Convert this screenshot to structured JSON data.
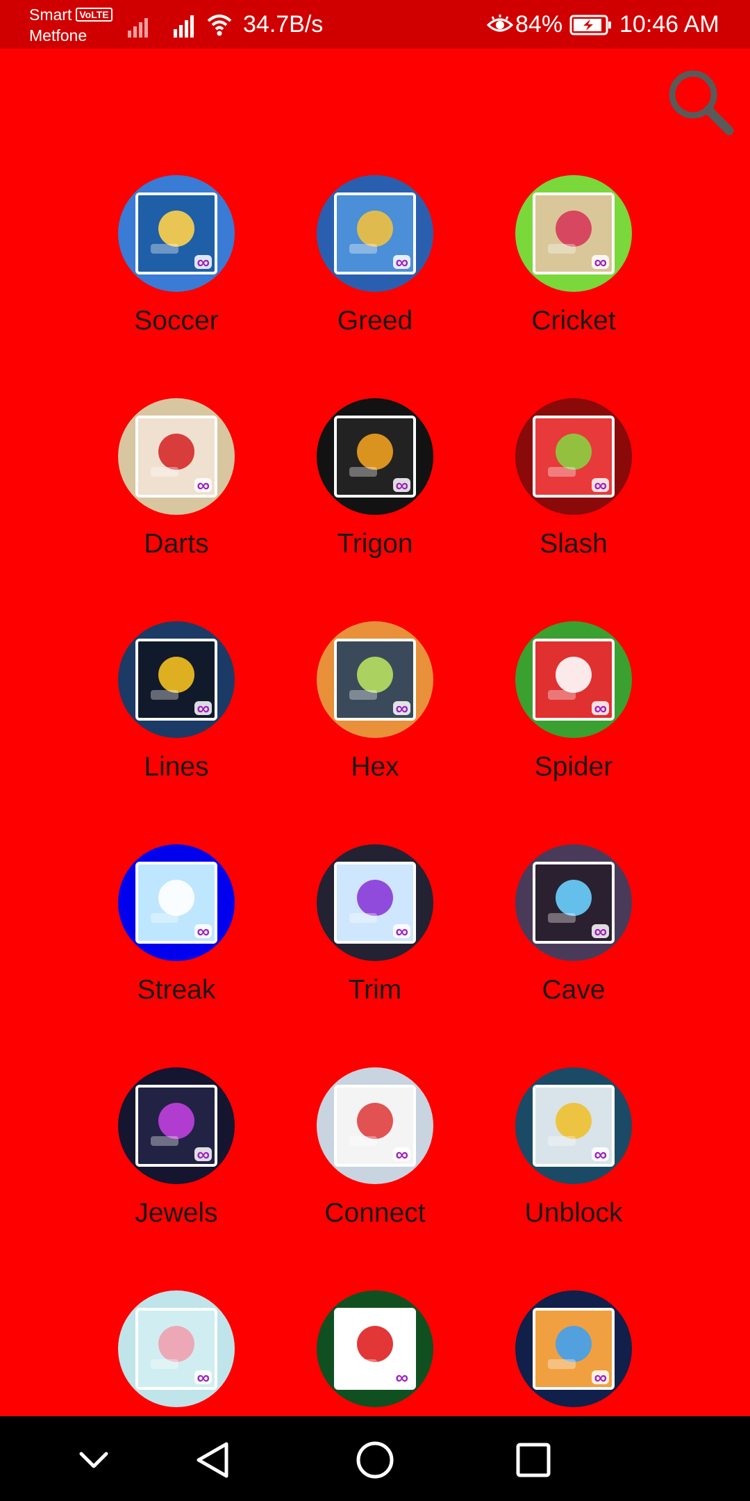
{
  "status_bar": {
    "carrier_line1": "Smart",
    "volte": "VoLTE",
    "carrier_line2": "Metfone",
    "net_speed": "34.7B/s",
    "battery_percent": "84%",
    "time": "10:46 AM"
  },
  "colors": {
    "background": "#fe0000",
    "status_bar": "#d10000",
    "nav_bar": "#000000"
  },
  "search": {
    "icon": "search-icon"
  },
  "games": [
    {
      "label": "Soccer",
      "circle": "#3a7bd5",
      "inner": "#1e5fa8",
      "accent": "#ffd24a"
    },
    {
      "label": "Greed",
      "circle": "#2a5fb0",
      "inner": "#4a8fd8",
      "accent": "#f0c040"
    },
    {
      "label": "Cricket",
      "circle": "#7ad83a",
      "inner": "#d9c79a",
      "accent": "#d63a5a"
    },
    {
      "label": "Darts",
      "circle": "#d8c6a0",
      "inner": "#f0e0d0",
      "accent": "#d52a2a"
    },
    {
      "label": "Trigon",
      "circle": "#121212",
      "inner": "#222222",
      "accent": "#f0a020"
    },
    {
      "label": "Slash",
      "circle": "#8a0a0a",
      "inner": "#e83a3a",
      "accent": "#8ad040"
    },
    {
      "label": "Lines",
      "circle": "#1c3a66",
      "inner": "#111a2a",
      "accent": "#f5c020"
    },
    {
      "label": "Hex",
      "circle": "#e8903a",
      "inner": "#3a4a5a",
      "accent": "#b8e060"
    },
    {
      "label": "Spider",
      "circle": "#3aa030",
      "inner": "#e03030",
      "accent": "#ffffff"
    },
    {
      "label": "Streak",
      "circle": "#0000ee",
      "inner": "#bfe6ff",
      "accent": "#ffffff"
    },
    {
      "label": "Trim",
      "circle": "#222233",
      "inner": "#cfe6ff",
      "accent": "#8a3ad8"
    },
    {
      "label": "Cave",
      "circle": "#4a3a5a",
      "inner": "#2a2030",
      "accent": "#6ad0ff"
    },
    {
      "label": "Jewels",
      "circle": "#151530",
      "inner": "#222244",
      "accent": "#c040e0"
    },
    {
      "label": "Connect",
      "circle": "#c8d4e0",
      "inner": "#f4f4f4",
      "accent": "#e04040"
    },
    {
      "label": "Unblock",
      "circle": "#1a4a66",
      "inner": "#d8e4ea",
      "accent": "#f0c030"
    },
    {
      "label": "",
      "circle": "#bfe4ea",
      "inner": "#d0eef2",
      "accent": "#f0a0b0"
    },
    {
      "label": "",
      "circle": "#105020",
      "inner": "#ffffff",
      "accent": "#e02020"
    },
    {
      "label": "",
      "circle": "#10204a",
      "inner": "#f0a040",
      "accent": "#40a0f0"
    }
  ],
  "nav": {
    "collapse": "chevron-down-icon",
    "back": "back-triangle-icon",
    "home": "home-circle-icon",
    "recents": "recents-square-icon"
  }
}
